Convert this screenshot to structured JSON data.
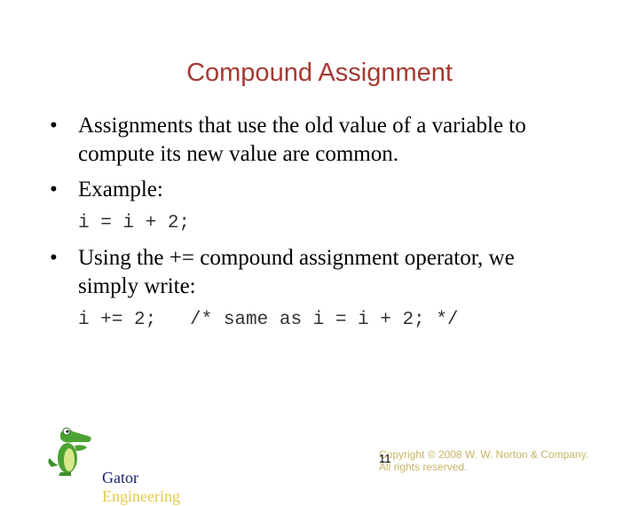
{
  "slide": {
    "title": "Compound Assignment",
    "bullets": [
      {
        "marker": "•",
        "text": "Assignments that use the old value of a variable to\ncompute its new value are common."
      },
      {
        "marker": "•",
        "text": "Example:"
      },
      {
        "marker": "•",
        "text": "Using the += compound assignment operator, we\nsimply write:"
      }
    ],
    "code": [
      "i = i + 2;",
      "i += 2;   /* same as i = i + 2; */"
    ]
  },
  "footer": {
    "logo_icon": "gator-mascot-icon",
    "brand_part1": "Gator",
    "brand_part2": "Engineering",
    "slide_number": "11",
    "copyright": "Copyright © 2008 W. W. Norton & Company.\nAll rights reserved."
  },
  "colors": {
    "title": "#a33a32",
    "brand_dark": "#1a1e6e",
    "brand_gold": "#e7c84a",
    "copyright": "#c9b465"
  }
}
